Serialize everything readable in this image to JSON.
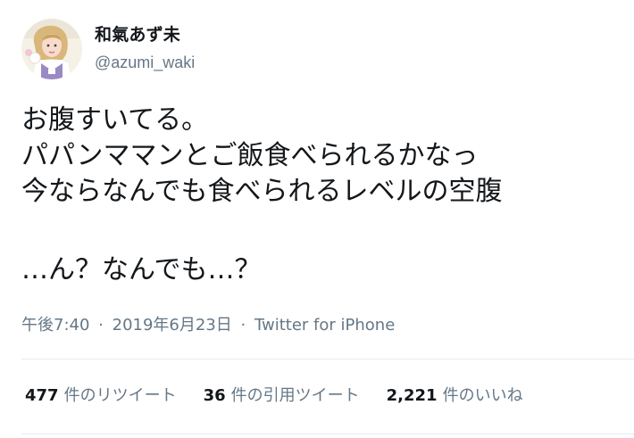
{
  "user": {
    "display_name": "和氣あず未",
    "handle": "@azumi_waki",
    "avatar": "avatar-photo"
  },
  "tweet": {
    "lines": [
      "お腹すいてる。",
      "パパンママンとご飯食べられるかなっ",
      "今ならなんでも食べられるレベルの空腹",
      "…ん？なんでも…？"
    ]
  },
  "meta": {
    "time": "午後7:40",
    "separator": "·",
    "date": "2019年6月23日",
    "source": "Twitter for iPhone"
  },
  "stats": {
    "retweets": {
      "count": "477",
      "label": "件のリツイート"
    },
    "quotes": {
      "count": "36",
      "label": "件の引用ツイート"
    },
    "likes": {
      "count": "2,221",
      "label": "件のいいね"
    }
  },
  "colors": {
    "text": "#14171a",
    "secondary": "#657786",
    "divider": "#e6ecf0"
  }
}
